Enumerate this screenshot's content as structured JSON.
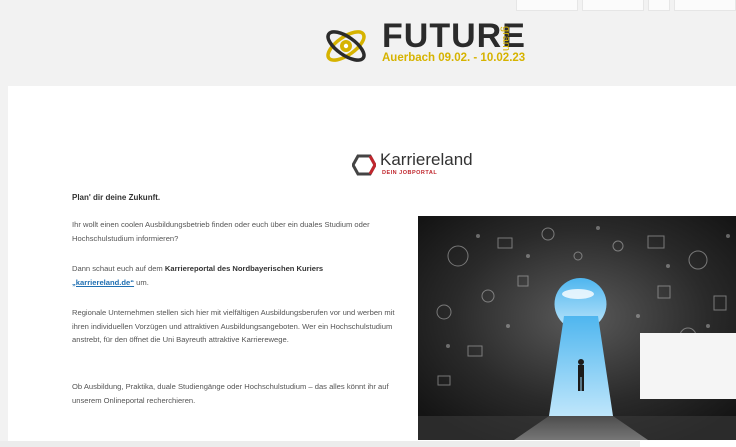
{
  "event": {
    "name": "FUTURE",
    "suffix": "gram",
    "subtitle": "Auerbach 09.02. - 10.02.23"
  },
  "partner_logo": {
    "name": "Karriereland",
    "tagline": "DEIN JOBPORTAL"
  },
  "article": {
    "heading": "Plan' dir deine Zukunft.",
    "p1": "Ihr wollt einen coolen Ausbildungsbetrieb finden oder euch über ein duales Studium oder Hochschulstudium informieren?",
    "p2_prefix": "Dann schaut euch auf dem ",
    "p2_bold": "Karriereportal des Nordbayerischen Kuriers",
    "p2_link": "„karriereland.de“",
    "p2_suffix": " um.",
    "p3": "Regionale Unternehmen stellen sich hier mit vielfältigen Ausbildungsberufen vor und werben mit ihren individuellen Vorzügen und attraktiven Ausbildungsangeboten. Wer ein Hochschulstudium anstrebt, für den öffnet die Uni Bayreuth attraktive Karrierewege.",
    "p4": "Ob Ausbildung, Praktika, duale Studiengänge oder Hochschulstudium – das alles könnt ihr auf unserem Onlineportal recherchieren."
  },
  "colors": {
    "accent_yellow": "#d6b300",
    "brand_red": "#c0262d",
    "link_blue": "#1f6fb2"
  }
}
